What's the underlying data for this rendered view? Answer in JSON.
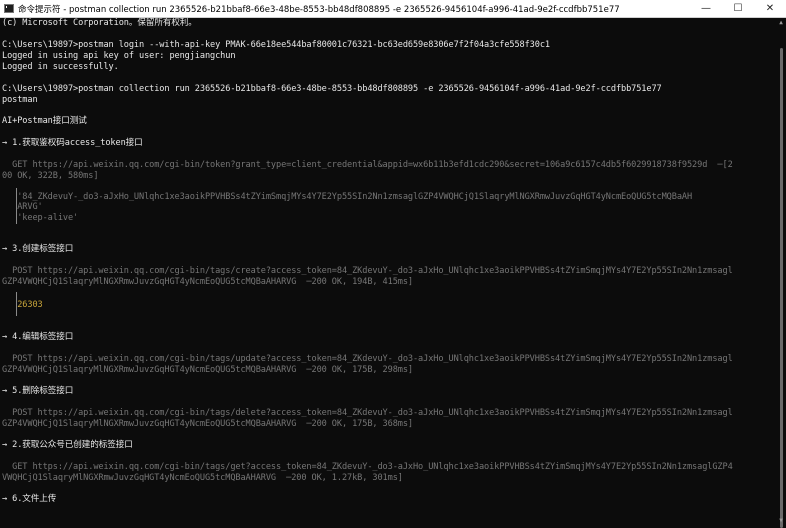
{
  "window": {
    "title": "命令提示符 - postman  collection run 2365526-b21bbaf8-66e3-48be-8553-bb48df808895 -e 2365526-9456104f-a996-41ad-9e2f-ccdfbb751e77",
    "minimize": "—",
    "maximize": "☐",
    "close": "✕"
  },
  "console": {
    "copyright": "(c) Microsoft Corporation。保留所有权利。",
    "login_cmd": "C:\\Users\\19897>postman login --with-api-key PMAK-66e18ee544baf80001c76321-bc63ed659e8306e7f2f04a3cfe558f30c1",
    "login_out1": "Logged in using api key of user: pengjiangchun",
    "login_out2": "Logged in successfully.",
    "run_cmd": "C:\\Users\\19897>postman collection run 2365526-b21bbaf8-66e3-48be-8553-bb48df808895 -e 2365526-9456104f-a996-41ad-9e2f-ccdfbb751e77",
    "run_out": "postman",
    "collection_name": "AI+Postman接口测试",
    "req1_title": "→ 1.获取鉴权码access_token接口",
    "req1_url1": "  GET https://api.weixin.qq.com/cgi-bin/token?grant_type=client_credential&appid=wx6b11b3efd1cdc290&secret=106a9c6157c4db5f6029918738f9529d  ─[2",
    "req1_url2": "00 OK, 322B, 580ms]",
    "req1_log1": "   '84_ZKdevuY-_do3-aJxHo_UNlqhc1xe3aoikPPVHBSs4tZYimSmqjMYs4Y7E2Yp55SIn2Nn1zmsaglGZP4VWQHCjQ1SlaqryMlNGXRmwJuvzGqHGT4yNcmEoQUG5tcMQBaAH",
    "req1_log2": "   ARVG'",
    "req1_log3": "   'keep-alive'",
    "req3_title": "→ 3.创建标签接口",
    "req3_url1": "  POST https://api.weixin.qq.com/cgi-bin/tags/create?access_token=84_ZKdevuY-_do3-aJxHo_UNlqhc1xe3aoikPPVHBSs4tZYimSmqjMYs4Y7E2Yp55SIn2Nn1zmsagl",
    "req3_url2": "GZP4VWQHCjQ1SlaqryMlNGXRmwJuvzGqHGT4yNcmEoQUG5tcMQBaAHARVG  ─200 OK, 194B, 415ms]",
    "req3_log1": "   26303",
    "req4_title": "→ 4.编辑标签接口",
    "req4_url1": "  POST https://api.weixin.qq.com/cgi-bin/tags/update?access_token=84_ZKdevuY-_do3-aJxHo_UNlqhc1xe3aoikPPVHBSs4tZYimSmqjMYs4Y7E2Yp55SIn2Nn1zmsagl",
    "req4_url2": "GZP4VWQHCjQ1SlaqryMlNGXRmwJuvzGqHGT4yNcmEoQUG5tcMQBaAHARVG  ─200 OK, 175B, 298ms]",
    "req5_title": "→ 5.删除标签接口",
    "req5_url1": "  POST https://api.weixin.qq.com/cgi-bin/tags/delete?access_token=84_ZKdevuY-_do3-aJxHo_UNlqhc1xe3aoikPPVHBSs4tZYimSmqjMYs4Y7E2Yp55SIn2Nn1zmsagl",
    "req5_url2": "GZP4VWQHCjQ1SlaqryMlNGXRmwJuvzGqHGT4yNcmEoQUG5tcMQBaAHARVG  ─200 OK, 175B, 368ms]",
    "req2_title": "→ 2.获取公众号已创建的标签接口",
    "req2_url1": "  GET https://api.weixin.qq.com/cgi-bin/tags/get?access_token=84_ZKdevuY-_do3-aJxHo_UNlqhc1xe3aoikPPVHBSs4tZYimSmqjMYs4Y7E2Yp55SIn2Nn1zmsaglGZP4",
    "req2_url2": "VWQHCjQ1SlaqryMlNGXRmwJuvzGqHGT4yNcmEoQUG5tcMQBaAHARVG  ─200 OK, 1.27kB, 301ms]",
    "req6_title": "→ 6.文件上传"
  },
  "colors": {
    "background": "#0c0c0c",
    "text": "#cccccc",
    "dim_text": "#767676",
    "highlight": "#c8a53a"
  }
}
